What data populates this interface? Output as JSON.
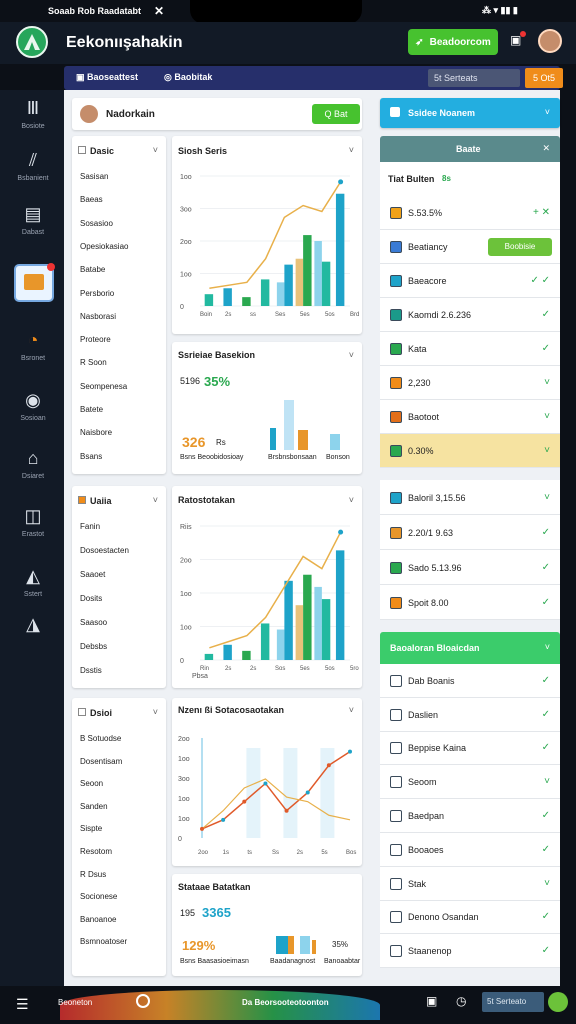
{
  "status": {
    "left": "Soaab Rob Raadatabt",
    "close": "✕",
    "right": "⁂ ▾ ▮▮ ▮"
  },
  "header": {
    "title": "Eekonıışahakin",
    "button": "Beadoorcom"
  },
  "topnav": {
    "item1": "Baoseattest",
    "item2": "Baobitak",
    "right": "5t Serteats",
    "orange": "5 Ot5"
  },
  "sidebar": [
    {
      "label": "Bosiote",
      "icon": "Ⅲ"
    },
    {
      "label": "Bsbanient",
      "icon": "⫽"
    },
    {
      "label": "Dabast",
      "icon": "▤"
    },
    {
      "label": "",
      "icon": "▦"
    },
    {
      "label": "Bsronet",
      "icon": "◔"
    },
    {
      "label": "Sosioan",
      "icon": "◉"
    },
    {
      "label": "Dsiaret",
      "icon": "⌂"
    },
    {
      "label": "Erastot",
      "icon": "◫"
    },
    {
      "label": "Sstert",
      "icon": "◭"
    },
    {
      "label": "",
      "icon": "◮"
    }
  ],
  "profile": {
    "name": "Nadorkain",
    "button": "Q Bat"
  },
  "list1": {
    "title": "Dasic",
    "items": [
      "Sasisan",
      "Baeas",
      "Sosasioo",
      "Opesiokasiao",
      "Batabe",
      "Persborio",
      "Nasborasi",
      "Proteore",
      "R Soon",
      "Seompenesa",
      "Batete",
      "Naisbore",
      "Bsans"
    ]
  },
  "list2": {
    "title": "Uaiia",
    "items": [
      "Fanin",
      "Dosoestacten",
      "Saaoet",
      "Dosits",
      "Saasoo",
      "Debsbs",
      "Dsstis"
    ]
  },
  "list3": {
    "title": "Dsioi",
    "items": [
      "B Sotuodse",
      "Dosentisam",
      "Seoon",
      "Sanden",
      "Sispte",
      "Resotom",
      "R Dsus",
      "Socionese",
      "Banoanoe",
      "Bsmnoatoser"
    ]
  },
  "chart1": {
    "title": "Siosh Seris",
    "yticks": [
      "1oo",
      "3oo",
      "2oo",
      "1oo",
      "0"
    ],
    "xticks": [
      "Boin",
      "2s",
      "ss",
      "Ses",
      "5es",
      "5os",
      "Brd"
    ]
  },
  "stat1": {
    "title": "Ssrieiae Basekion",
    "pct_a": "5196",
    "pct_b": "35%",
    "num": "326",
    "small": "Rs",
    "foot1": "Bsns  Beoobidosioay",
    "foot2": "Brsbnsbonsaan",
    "foot3": "Bonson"
  },
  "chart2": {
    "title": "Ratostotakan",
    "yticks": [
      "Riis",
      "2oo",
      "1oo",
      "1oo",
      "0"
    ],
    "xticks": [
      "Rin",
      "2s",
      "2s",
      "Sos",
      "5es",
      "5os",
      "5ro"
    ],
    "xlabel": "Pbsa"
  },
  "chart3": {
    "title": "Nzenı ßi Sotacosaotakan",
    "yticks": [
      "2oo",
      "1oo",
      "3oo",
      "1oo",
      "1oo",
      "0"
    ],
    "xticks": [
      "2oo",
      "1s",
      "ts",
      "Ss",
      "2s",
      "5s",
      "Bos"
    ]
  },
  "stat2": {
    "title": "Stataae Batatkan",
    "pct_a": "195",
    "pct_b": "3365",
    "num": "129%",
    "foot1": "Bsns  Baasasioeimasn",
    "foot2": "Baadanagnost",
    "pct_c": "35%",
    "foot3": "Banoaabtar"
  },
  "right": {
    "top_button": "Ssidee Noanem",
    "panel_title": "Baate",
    "panel_sub": "Tiat Bulten",
    "panel_sub_tag": "8s",
    "rows": [
      {
        "label": "S.53.5%",
        "mark": "+ ✕",
        "color": "#f0a21a"
      },
      {
        "label": "Beatiancy",
        "button": "Boobisie",
        "color": "#3a7bd5"
      },
      {
        "label": "Baeacore",
        "mark": "✓ ✓",
        "color": "#1ea3c9"
      },
      {
        "label": "Kaomdi 2.6.236",
        "mark": "✓",
        "color": "#1b9a8a"
      },
      {
        "label": "Kata",
        "mark": "✓",
        "color": "#2aa84f"
      },
      {
        "label": "2,230",
        "mark": "˅",
        "color": "#f08c1a"
      },
      {
        "label": "Baotoot",
        "mark": "˅",
        "color": "#e26f1a"
      },
      {
        "label": "0.30%",
        "mark": "˅",
        "color": "#2aa84f",
        "highlight": true
      }
    ],
    "group2": [
      {
        "label": "Baloril 3,15.56",
        "mark": "˅",
        "color": "#1ea3c9"
      },
      {
        "label": "2.20/1 9.63",
        "mark": "✓",
        "color": "#e8962a"
      },
      {
        "label": "Sado 5.13.96",
        "mark": "✓",
        "color": "#2aa84f"
      },
      {
        "label": "Spoit 8.00",
        "mark": "✓",
        "color": "#f08c1a"
      }
    ],
    "group3_title": "Baoaloran Bloaicdan",
    "group3": [
      {
        "label": "Dab Boanis",
        "mark": "✓"
      },
      {
        "label": "Daslien",
        "mark": "✓"
      },
      {
        "label": "Beppise Kaina",
        "mark": "✓"
      },
      {
        "label": "Seoom",
        "mark": "˅"
      },
      {
        "label": "Baedpan",
        "mark": "✓"
      },
      {
        "label": "Booaoes",
        "mark": "✓"
      },
      {
        "label": "Stak",
        "mark": "˅"
      },
      {
        "label": "Denono Osandan",
        "mark": "✓"
      },
      {
        "label": "Staanenop",
        "mark": "✓"
      }
    ]
  },
  "bottom": {
    "left": "Beoneton",
    "center": "Da Beorsooteotoonton",
    "right": "5t Serteato"
  },
  "chart_data": [
    {
      "type": "bar",
      "title": "Siosh Seris",
      "series": [
        {
          "values": [
            20,
            30,
            15,
            45,
            70,
            120,
            75,
            190
          ]
        },
        {
          "values": [
            0,
            0,
            0,
            0,
            40,
            80,
            110,
            0
          ]
        }
      ],
      "line": [
        30,
        35,
        40,
        80,
        150,
        170,
        160,
        210
      ]
    },
    {
      "type": "bar",
      "title": "Ratostotakan",
      "series": [
        {
          "values": [
            10,
            25,
            15,
            60,
            130,
            140,
            100,
            180
          ]
        },
        {
          "values": [
            0,
            0,
            0,
            0,
            50,
            90,
            120,
            0
          ]
        }
      ],
      "line": [
        20,
        30,
        40,
        70,
        120,
        170,
        150,
        210
      ]
    },
    {
      "type": "line",
      "title": "Nzenı ßi Sotacosaotakan",
      "series": [
        {
          "values": [
            20,
            40,
            80,
            120,
            60,
            100,
            160,
            190
          ]
        }
      ],
      "line2": [
        20,
        60,
        110,
        130,
        90,
        80,
        50,
        40
      ]
    }
  ]
}
